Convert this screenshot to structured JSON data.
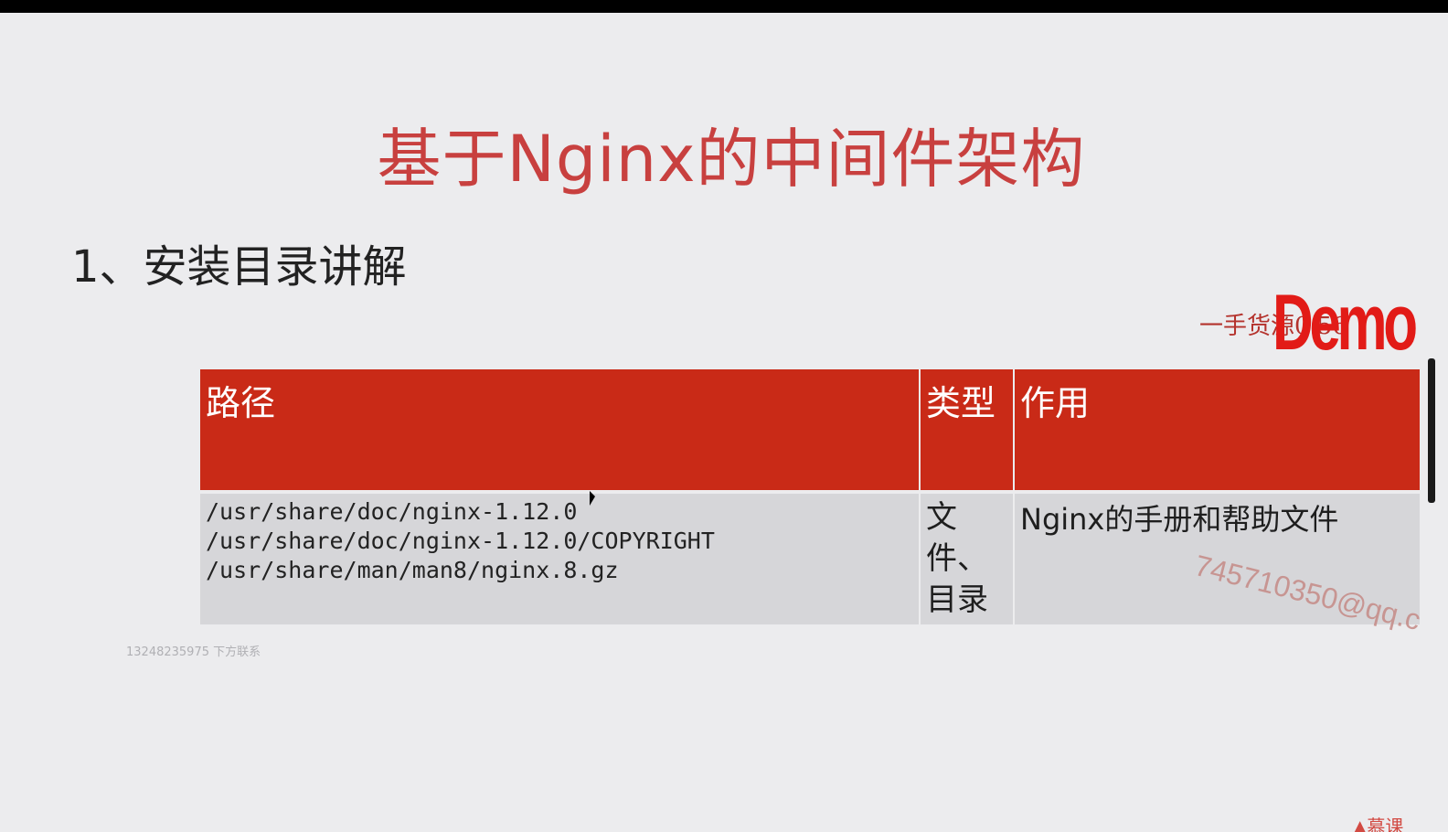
{
  "slide": {
    "title": "基于Nginx的中间件架构",
    "section_heading": "1、安装目录讲解"
  },
  "watermarks": {
    "top_line": "一手货源0          56",
    "logo_text": "Demo",
    "email": "745710350@qq.c",
    "phone": "13248235975 下方联系",
    "corner": "▲慕课"
  },
  "table": {
    "headers": {
      "path": "路径",
      "type": "类型",
      "purpose": "作用"
    },
    "rows": [
      {
        "paths": [
          "/usr/share/doc/nginx-1.12.0",
          "/usr/share/doc/nginx-1.12.0/COPYRIGHT",
          "/usr/share/man/man8/nginx.8.gz"
        ],
        "type": "文件、目录",
        "purpose": "Nginx的手册和帮助文件"
      }
    ]
  },
  "colors": {
    "title": "#c8403f",
    "header_bg": "#c92a17",
    "row_bg": "#d6d6d9",
    "background": "#ececee"
  }
}
